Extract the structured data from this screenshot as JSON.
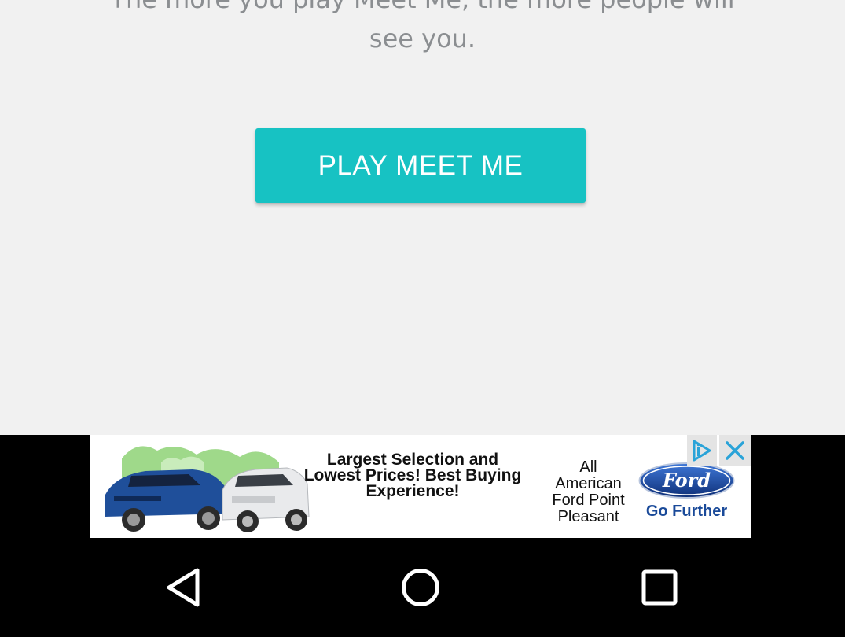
{
  "main": {
    "promo_line1": "The more you play Meet Me, the more people will",
    "promo_line2": "see you.",
    "play_button_label": "PLAY MEET ME"
  },
  "ad": {
    "headline_line1": "Largest Selection and",
    "headline_line2": "Lowest Prices! Best Buying",
    "headline_line3": "Experience!",
    "advertiser_line1": "All",
    "advertiser_line2": "American",
    "advertiser_line3": "Ford Point",
    "advertiser_line4": "Pleasant",
    "brand_logo_text": "Ford",
    "tagline": "Go Further",
    "choices_icon": "adchoices-icon",
    "close_icon": "close-icon"
  },
  "nav": {
    "back_icon": "back-triangle-icon",
    "home_icon": "home-circle-icon",
    "recents_icon": "recents-square-icon"
  },
  "colors": {
    "background": "#f1f1f1",
    "accent": "#17c2c3",
    "promo_text": "#8b8e91",
    "ford_blue": "#1a4a99"
  }
}
